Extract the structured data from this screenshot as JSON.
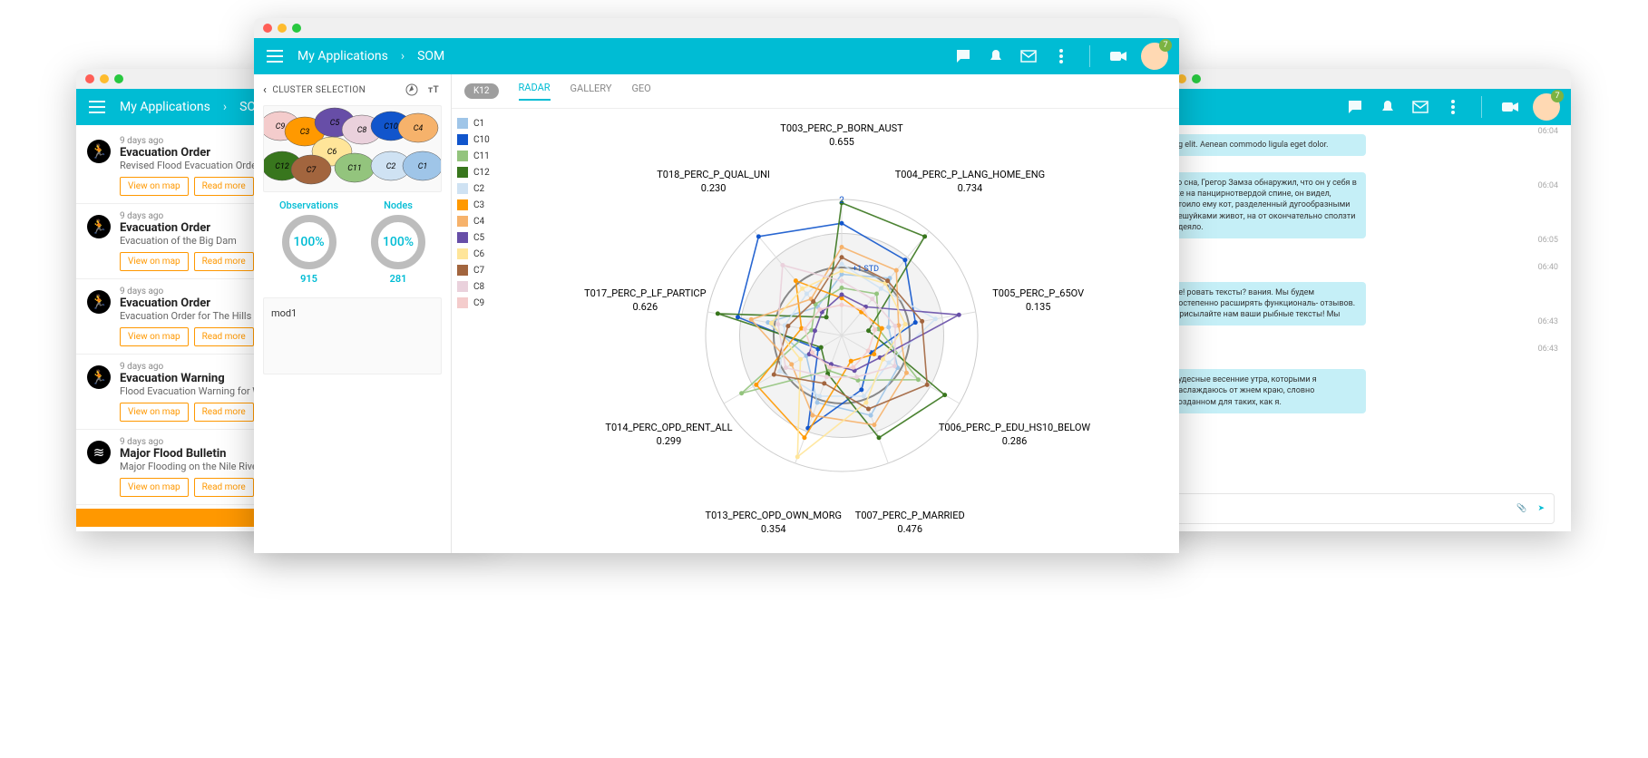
{
  "header": {
    "crumb1": "My Applications",
    "crumb2": "SOM",
    "avatar_badge": "7"
  },
  "feed": [
    {
      "time": "9 days ago",
      "title": "Evacuation Order",
      "desc": "Revised Flood Evacuation Order For W Edward St Wagga",
      "icon": "run"
    },
    {
      "time": "9 days ago",
      "title": "Evacuation Order",
      "desc": "Evacuation of the Big Dam",
      "icon": "run"
    },
    {
      "time": "9 days ago",
      "title": "Evacuation Order",
      "desc": "Evacuation Order for The Hills",
      "icon": "run"
    },
    {
      "time": "9 days ago",
      "title": "Evacuation Warning",
      "desc": "Flood Evacuation Warning for Wollong",
      "icon": "run"
    },
    {
      "time": "9 days ago",
      "title": "Major Flood Bulletin",
      "desc": "Major Flooding on the Nile River",
      "icon": "wave"
    }
  ],
  "feed_buttons": {
    "map": "View on map",
    "read": "Read more"
  },
  "cluster_panel": {
    "title": "CLUSTER SELECTION",
    "obs_label": "Observations",
    "obs_pct": "100%",
    "obs_count": "915",
    "nodes_label": "Nodes",
    "nodes_pct": "100%",
    "nodes_count": "281",
    "model": "mod1",
    "cells": [
      "C1",
      "C2",
      "C3",
      "C4",
      "C5",
      "C6",
      "C7",
      "C8",
      "C9",
      "C10",
      "C11",
      "C12"
    ]
  },
  "tabs": {
    "pill": "K12",
    "t1": "RADAR",
    "t2": "GALLERY",
    "t3": "GEO"
  },
  "legend": [
    {
      "label": "C1",
      "color": "#9fc5e8"
    },
    {
      "label": "C10",
      "color": "#1155cc"
    },
    {
      "label": "C11",
      "color": "#93c47d"
    },
    {
      "label": "C12",
      "color": "#38761d"
    },
    {
      "label": "C2",
      "color": "#cfe2f3"
    },
    {
      "label": "C3",
      "color": "#ff9900"
    },
    {
      "label": "C4",
      "color": "#f6b26b"
    },
    {
      "label": "C5",
      "color": "#674ea7"
    },
    {
      "label": "C6",
      "color": "#ffe599"
    },
    {
      "label": "C7",
      "color": "#a2653e"
    },
    {
      "label": "C8",
      "color": "#ead1dc"
    },
    {
      "label": "C9",
      "color": "#f4cccc"
    }
  ],
  "radar_labels": [
    {
      "label": "T003_PERC_P_BORN_AUST",
      "value": "0.655",
      "angle": 0
    },
    {
      "label": "T004_PERC_P_LANG_HOME_ENG",
      "value": "0.734",
      "angle": 40
    },
    {
      "label": "T005_PERC_P_65OV",
      "value": "0.135",
      "angle": 80
    },
    {
      "label": "T006_PERC_P_EDU_HS10_BELOW",
      "value": "0.286",
      "angle": 120
    },
    {
      "label": "T007_PERC_P_MARRIED",
      "value": "0.476",
      "angle": 160
    },
    {
      "label": "T013_PERC_OPD_OWN_MORG",
      "value": "0.354",
      "angle": 200
    },
    {
      "label": "T014_PERC_OPD_RENT_ALL",
      "value": "0.299",
      "angle": 240
    },
    {
      "label": "T017_PERC_P_LF_PARTICP",
      "value": "0.626",
      "angle": 280
    },
    {
      "label": "T018_PERC_P_QUAL_UNI",
      "value": "0.230",
      "angle": 320
    }
  ],
  "radar_marks": {
    "ring2": "2",
    "std": "+1 STD"
  },
  "chat": {
    "msgs": [
      {
        "text": "ng elit. Aenean commodo ligula eget dolor.",
        "time": "06:04"
      },
      {
        "text": "то сна, Грегор Замза обнаружил, что он у себя в\nже на панцирнотвердой спине, он видел, стоило ему\nкот, разделенный дугообразными чешуйками живот, на\nот окончательно сползти одеяло.",
        "time": "06:04"
      },
      {
        "text": "",
        "time": "06:05"
      },
      {
        "text": "ие!\nровать тексты?\nвания. Мы будем постепенно расширять функциональ-\nотзывов. Присылайте нам ваши рыбные тексты! Мы",
        "time": "06:40"
      },
      {
        "text": "",
        "time": "06:43"
      },
      {
        "text": "чудесные весенние утра, которыми я наслаждаюсь от\nжнем краю, словно созданном для таких, как я.",
        "time": "06:43"
      }
    ]
  },
  "chart_data": {
    "type": "radar",
    "title": "",
    "axes": [
      "T003_PERC_P_BORN_AUST",
      "T004_PERC_P_LANG_HOME_ENG",
      "T005_PERC_P_65OV",
      "T006_PERC_P_EDU_HS10_BELOW",
      "T007_PERC_P_MARRIED",
      "T013_PERC_OPD_OWN_MORG",
      "T014_PERC_OPD_RENT_ALL",
      "T017_PERC_P_LF_PARTICP",
      "T018_PERC_P_QUAL_UNI"
    ],
    "axis_display_values": [
      0.655,
      0.734,
      0.135,
      0.286,
      0.476,
      0.354,
      0.299,
      0.626,
      0.23
    ],
    "rings": [
      1,
      2
    ],
    "reference": "+1 STD",
    "series": [
      {
        "name": "C1",
        "color": "#9fc5e8",
        "values": [
          0.9,
          1.1,
          0.7,
          0.95,
          1.25,
          1.05,
          0.6,
          1.1,
          0.55
        ]
      },
      {
        "name": "C10",
        "color": "#1155cc",
        "values": [
          1.65,
          1.45,
          1.1,
          0.5,
          0.85,
          1.45,
          0.4,
          1.55,
          1.9
        ]
      },
      {
        "name": "C11",
        "color": "#93c47d",
        "values": [
          0.7,
          0.8,
          0.55,
          1.3,
          0.7,
          0.55,
          1.7,
          0.45,
          0.6
        ]
      },
      {
        "name": "C12",
        "color": "#38761d",
        "values": [
          1.95,
          1.9,
          0.4,
          1.75,
          1.6,
          0.6,
          0.35,
          1.85,
          0.35
        ]
      },
      {
        "name": "C2",
        "color": "#cfe2f3",
        "values": [
          1.05,
          0.9,
          1.4,
          0.8,
          0.95,
          0.95,
          1.05,
          0.85,
          0.8
        ]
      },
      {
        "name": "C3",
        "color": "#ff9900",
        "values": [
          0.55,
          0.45,
          0.6,
          0.55,
          0.4,
          1.6,
          1.45,
          0.6,
          1.05
        ]
      },
      {
        "name": "C4",
        "color": "#f6b26b",
        "values": [
          1.3,
          1.25,
          0.85,
          1.1,
          1.4,
          1.25,
          0.85,
          1.35,
          0.7
        ]
      },
      {
        "name": "C5",
        "color": "#674ea7",
        "values": [
          0.6,
          0.55,
          1.75,
          0.65,
          0.55,
          0.45,
          0.55,
          0.4,
          0.45
        ]
      },
      {
        "name": "C6",
        "color": "#ffe599",
        "values": [
          0.95,
          1.0,
          0.95,
          0.7,
          1.05,
          1.9,
          0.7,
          1.05,
          0.9
        ]
      },
      {
        "name": "C7",
        "color": "#a2653e",
        "values": [
          1.15,
          1.05,
          1.2,
          1.45,
          1.15,
          0.75,
          1.15,
          0.8,
          0.65
        ]
      },
      {
        "name": "C8",
        "color": "#ead1dc",
        "values": [
          0.8,
          0.7,
          0.8,
          0.9,
          0.65,
          0.65,
          0.95,
          0.95,
          1.35
        ]
      },
      {
        "name": "C9",
        "color": "#f4cccc",
        "values": [
          0.45,
          0.5,
          0.5,
          0.45,
          0.5,
          0.5,
          0.5,
          0.55,
          0.5
        ]
      }
    ]
  }
}
